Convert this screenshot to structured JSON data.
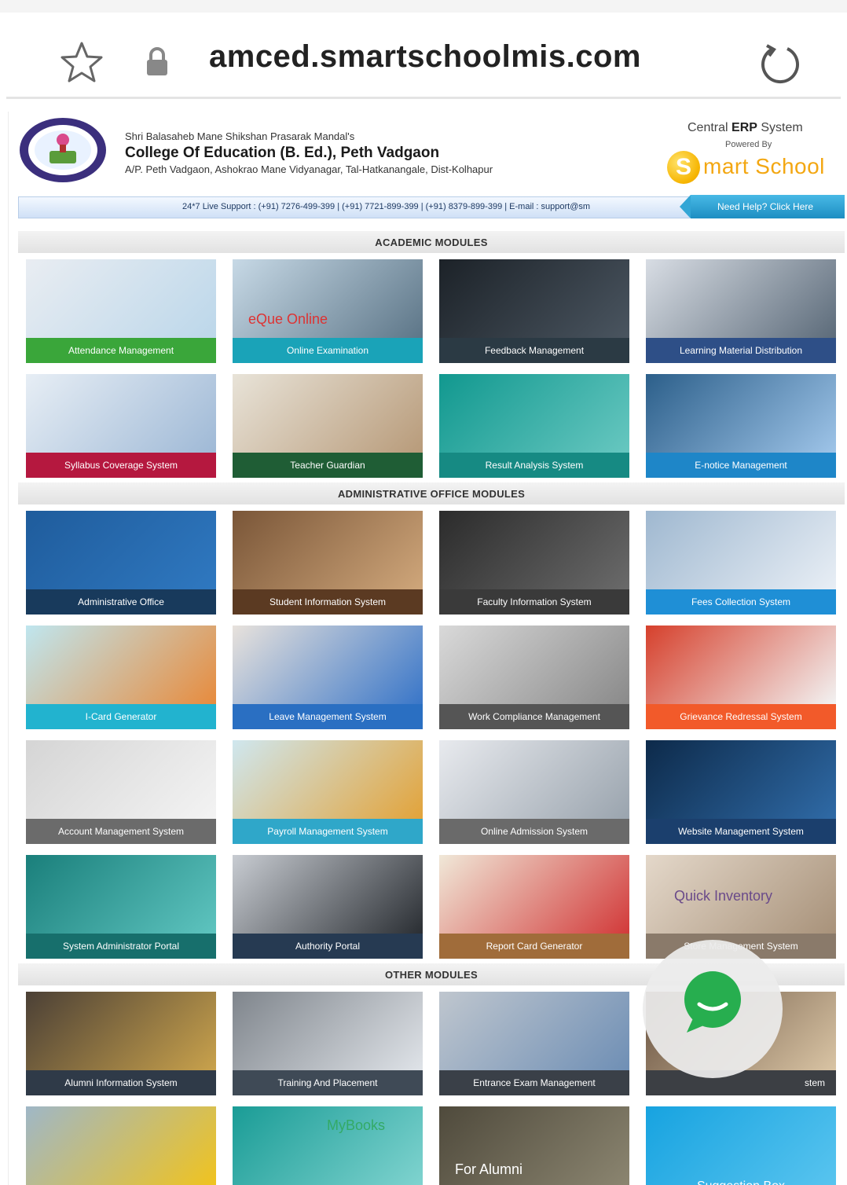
{
  "browser": {
    "url": "amced.smartschoolmis.com"
  },
  "header": {
    "mandal": "Shri Balasaheb Mane Shikshan Prasarak Mandal's",
    "college": "College Of Education (B. Ed.), Peth Vadgaon",
    "address": "A/P. Peth Vadgaon, Ashokrao Mane Vidyanagar, Tal-Hatkanangale, Dist-Kolhapur",
    "erp_prefix": "Central ",
    "erp_bold": "ERP",
    "erp_suffix": " System",
    "powered_by": "Powered By",
    "brand_initial": "S",
    "brand_rest": "mart School"
  },
  "support": {
    "text": "24*7 Live Support : (+91) 7276-499-399 | (+91) 7721-899-399 | (+91) 8379-899-399 | E-mail : support@sm",
    "help_button": "Need Help? Click Here"
  },
  "sections": {
    "academic": "ACADEMIC MODULES",
    "administrative": "ADMINISTRATIVE OFFICE MODULES",
    "other": "OTHER MODULES"
  },
  "academic_modules": [
    {
      "label": "Attendance Management",
      "color": "#3aa63a"
    },
    {
      "label": "Online Examination",
      "color": "#1aa3b8",
      "overlay": "eQue Online"
    },
    {
      "label": "Feedback Management",
      "color": "#2b3a44"
    },
    {
      "label": "Learning Material Distribution",
      "color": "#2e4f87"
    },
    {
      "label": "Syllabus Coverage System",
      "color": "#b5183f"
    },
    {
      "label": "Teacher Guardian",
      "color": "#1f5d35"
    },
    {
      "label": "Result Analysis System",
      "color": "#168a83"
    },
    {
      "label": "E-notice Management",
      "color": "#1e86c8"
    }
  ],
  "admin_modules": [
    {
      "label": "Administrative Office",
      "color": "#183a5c"
    },
    {
      "label": "Student Information System",
      "color": "#5b3a22"
    },
    {
      "label": "Faculty Information System",
      "color": "#3a3a3a"
    },
    {
      "label": "Fees Collection System",
      "color": "#1f8fd6"
    },
    {
      "label": "I-Card Generator",
      "color": "#22b3cf"
    },
    {
      "label": "Leave Management System",
      "color": "#2a6fc2"
    },
    {
      "label": "Work Compliance Management",
      "color": "#555555"
    },
    {
      "label": "Grievance Redressal System",
      "color": "#f25a2a"
    },
    {
      "label": "Account Management System",
      "color": "#6b6b6b"
    },
    {
      "label": "Payroll Management System",
      "color": "#2fa7c9"
    },
    {
      "label": "Online Admission System",
      "color": "#6a6a6a"
    },
    {
      "label": "Website Management System",
      "color": "#1b3f6d"
    },
    {
      "label": "System Administrator Portal",
      "color": "#176f6c"
    },
    {
      "label": "Authority Portal",
      "color": "#263a52"
    },
    {
      "label": "Report Card Generator",
      "color": "#a06c3a"
    },
    {
      "label": "Store Management System",
      "color": "#8a7a6a",
      "overlay": "Quick Inventory"
    }
  ],
  "other_modules": [
    {
      "label": "Alumni Information System",
      "color": "#2f3a48"
    },
    {
      "label": "Training And Placement",
      "color": "#3f4a56"
    },
    {
      "label": "Entrance Exam Management",
      "color": "#3a4048"
    },
    {
      "label": "stem",
      "color": "#3c3f44"
    },
    {
      "label": "",
      "color": "#d9a41c"
    },
    {
      "label": "",
      "color": "#17a5a0",
      "overlay": "MyBooks"
    },
    {
      "label": "",
      "color": "#4a4a42",
      "overlay": "For Alumni"
    },
    {
      "label": "Suggestion Box",
      "color": "#17a3e0"
    }
  ],
  "colors": {
    "chat_green": "#27ae4f",
    "brand_orange": "#f3a712"
  },
  "icons": {
    "bookmark": "star-icon",
    "secure": "lock-icon",
    "reload": "reload-icon",
    "chat": "chat-bubble-icon"
  }
}
